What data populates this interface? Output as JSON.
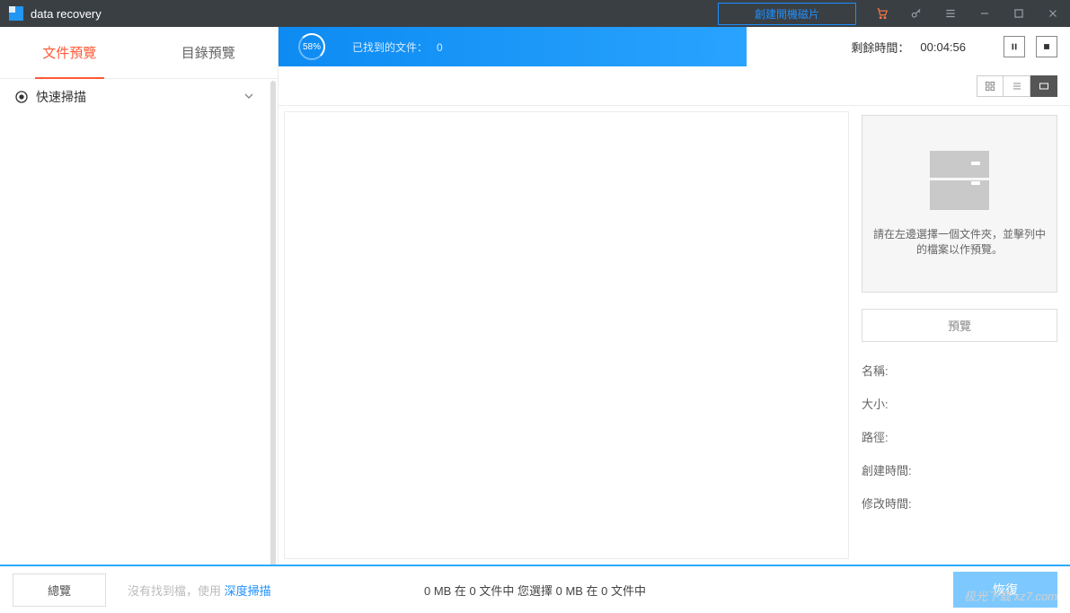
{
  "titlebar": {
    "app_title": "data recovery",
    "boot_disk_btn": "創建開機磁片"
  },
  "sidebar": {
    "tabs": {
      "file_preview": "文件預覽",
      "dir_preview": "目錄預覽"
    },
    "tree": {
      "quick_scan": "快速掃描"
    }
  },
  "progress": {
    "percent": "58%",
    "found_label": "已找到的文件：",
    "found_count": "0",
    "remain_label": "剩餘時間：",
    "remain_value": "00:04:56"
  },
  "preview": {
    "placeholder": "請在左邊選擇一個文件夾，並擊列中的檔案以作預覽。",
    "preview_btn": "預覽",
    "meta": {
      "name": "名稱:",
      "size": "大小:",
      "path": "路徑:",
      "ctime": "創建時間:",
      "mtime": "修改時間:"
    }
  },
  "footer": {
    "overview_btn": "總覽",
    "hint_prefix": "沒有找到檔，使用 ",
    "hint_link": "深度掃描",
    "stats": "0 MB 在 0 文件中  您選擇 0 MB 在 0 文件中",
    "recover_btn": "恢復",
    "watermark": "极光下载 xz7.com"
  }
}
